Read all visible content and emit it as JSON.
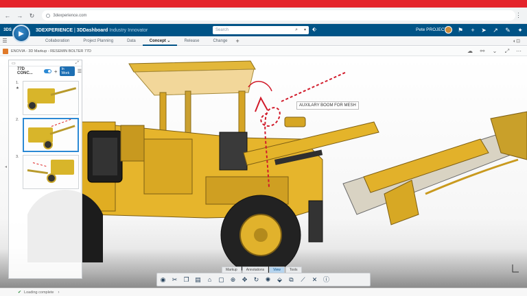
{
  "browser": {
    "url": "3dexperience.com",
    "back_icon": "arrow-left-icon",
    "forward_icon": "arrow-right-icon",
    "reload_icon": "reload-icon"
  },
  "app": {
    "brand": "3DEXPERIENCE",
    "separator": " | ",
    "dashboard": "3DDashboard",
    "context": "Industry Innovator",
    "search_placeholder": "Search",
    "user": "Pete PROJECT",
    "accent": "#005386"
  },
  "tabs": [
    {
      "label": "Collaboration"
    },
    {
      "label": "Project Planning"
    },
    {
      "label": "Data"
    },
    {
      "label": "Concept",
      "active": true
    },
    {
      "label": "Release"
    },
    {
      "label": "Change"
    }
  ],
  "widget": {
    "title": "ENOVIA - 3D Markup - RESEMIN BOLTER 77D"
  },
  "storyboard": {
    "title": "77D CONC...",
    "status": "In Work",
    "slides": [
      {
        "num": "1.",
        "mark": "★"
      },
      {
        "num": "2.",
        "mark": ""
      },
      {
        "num": "3.",
        "mark": ""
      }
    ]
  },
  "annotation": {
    "text": "AUXILARY BOOM FOR MESH",
    "color": "#d11a2a"
  },
  "toolbar": {
    "tabs": [
      "Markup",
      "Annotations",
      "View",
      "Tools"
    ],
    "active_tab": "View",
    "icons": [
      "camera-icon",
      "scissors-icon",
      "copy-icon",
      "paste-icon",
      "home-icon",
      "fit-all-icon",
      "zoom-icon",
      "pan-icon",
      "rotate-icon",
      "lighting-icon",
      "view-orientation-icon",
      "section-icon",
      "measure-icon",
      "close-icon",
      "info-icon"
    ]
  },
  "status": {
    "text": "Loading complete"
  }
}
